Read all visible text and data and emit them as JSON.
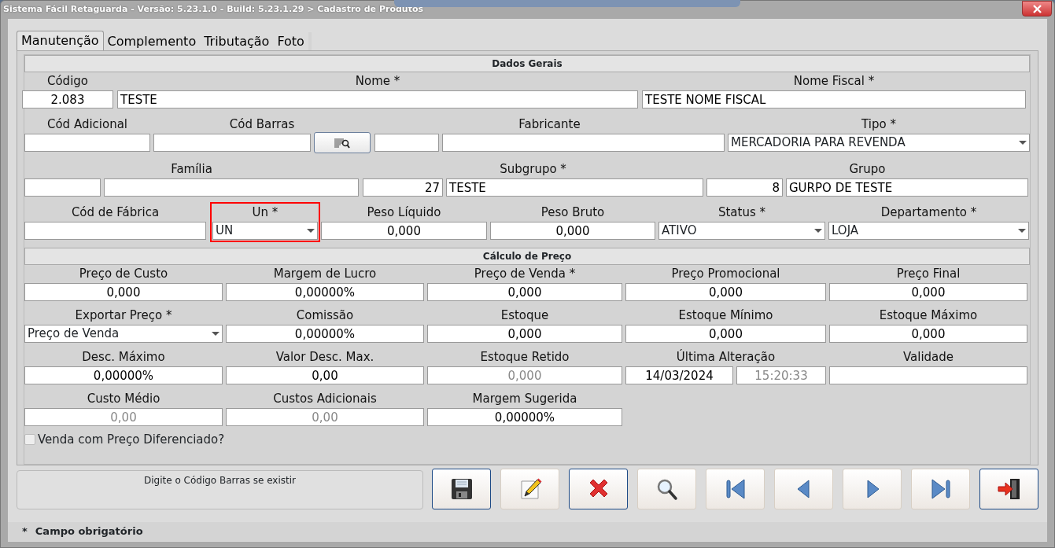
{
  "window": {
    "title": "Sistema Fácil Retaguarda - Versão: 5.23.1.0  - Build: 5.23.1.29 > Cadastro de Produtos"
  },
  "tabs": [
    {
      "label": "Manutenção",
      "selected": true
    },
    {
      "label": "Complemento",
      "selected": false
    },
    {
      "label": "Tributação",
      "selected": false
    },
    {
      "label": "Foto",
      "selected": false
    }
  ],
  "sections": [
    {
      "title": "Dados Gerais",
      "rows": [
        {
          "fields": [
            {
              "label": "Código",
              "inputs": [
                {
                  "kind": "text",
                  "value": "2.083"
                }
              ]
            },
            {
              "label": "Nome *",
              "inputs": [
                {
                  "kind": "text",
                  "value": "TESTE"
                }
              ]
            },
            {
              "label": "Nome Fiscal *",
              "inputs": [
                {
                  "kind": "text",
                  "value": "TESTE NOME FISCAL"
                }
              ]
            }
          ]
        },
        {
          "fields": [
            {
              "label": "Cód Adicional",
              "inputs": [
                {
                  "kind": "text"
                }
              ]
            },
            {
              "label": "Cód Barras",
              "inputs": [
                {
                  "kind": "text"
                },
                {
                  "kind": "button"
                }
              ]
            },
            {
              "label": "Fabricante",
              "inputs": [
                {
                  "kind": "text"
                },
                {
                  "kind": "text"
                }
              ]
            },
            {
              "label": "Tipo *",
              "inputs": [
                {
                  "kind": "select",
                  "value": "MERCADORIA PARA REVENDA"
                }
              ]
            }
          ]
        },
        {
          "fields": [
            {
              "label": "Família",
              "inputs": [
                {
                  "kind": "text"
                },
                {
                  "kind": "text"
                }
              ]
            },
            {
              "label": "Subgrupo *",
              "inputs": [
                {
                  "kind": "text",
                  "value": "27"
                },
                {
                  "kind": "text",
                  "value": "TESTE"
                }
              ]
            },
            {
              "label": "Grupo",
              "inputs": [
                {
                  "kind": "text",
                  "value": "8"
                },
                {
                  "kind": "text",
                  "value": "GURPO DE TESTE"
                }
              ]
            }
          ]
        },
        {
          "fields": [
            {
              "label": "Cód de Fábrica",
              "inputs": [
                {
                  "kind": "text"
                }
              ]
            },
            {
              "label": "Un *",
              "highlighted": true,
              "inputs": [
                {
                  "kind": "select",
                  "value": "UN"
                }
              ]
            },
            {
              "label": "Peso Líquido",
              "inputs": [
                {
                  "kind": "text",
                  "value": "0,000"
                }
              ]
            },
            {
              "label": "Peso Bruto",
              "inputs": [
                {
                  "kind": "text",
                  "value": "0,000"
                }
              ]
            },
            {
              "label": "Status *",
              "inputs": [
                {
                  "kind": "select",
                  "value": "ATIVO"
                }
              ]
            },
            {
              "label": "Departamento *",
              "inputs": [
                {
                  "kind": "select",
                  "value": "LOJA"
                }
              ]
            }
          ]
        }
      ]
    },
    {
      "title": "Cálculo de Preço",
      "rows": [
        {
          "fields": [
            {
              "label": "Preço de Custo",
              "inputs": [
                {
                  "kind": "text",
                  "value": "0,000"
                }
              ]
            },
            {
              "label": "Margem de Lucro",
              "inputs": [
                {
                  "kind": "text",
                  "value": "0,00000%"
                }
              ]
            },
            {
              "label": "Preço de Venda *",
              "inputs": [
                {
                  "kind": "text",
                  "value": "0,000"
                }
              ]
            },
            {
              "label": "Preço Promocional",
              "inputs": [
                {
                  "kind": "text",
                  "value": "0,000"
                }
              ]
            },
            {
              "label": "Preço Final",
              "inputs": [
                {
                  "kind": "text",
                  "value": "0,000"
                }
              ]
            }
          ]
        },
        {
          "fields": [
            {
              "label": "Exportar Preço *",
              "inputs": [
                {
                  "kind": "select",
                  "value": "Preço de Venda"
                }
              ]
            },
            {
              "label": "Comissão",
              "inputs": [
                {
                  "kind": "text",
                  "value": "0,00000%"
                }
              ]
            },
            {
              "label": "Estoque",
              "inputs": [
                {
                  "kind": "text",
                  "value": "0,000"
                }
              ]
            },
            {
              "label": "Estoque Mínimo",
              "inputs": [
                {
                  "kind": "text",
                  "value": "0,000"
                }
              ]
            },
            {
              "label": "Estoque Máximo",
              "inputs": [
                {
                  "kind": "text",
                  "value": "0,000"
                }
              ]
            }
          ]
        },
        {
          "fields": [
            {
              "label": "Desc. Máximo",
              "inputs": [
                {
                  "kind": "text",
                  "value": "0,00000%"
                }
              ]
            },
            {
              "label": "Valor Desc. Max.",
              "inputs": [
                {
                  "kind": "text",
                  "value": "0,00"
                }
              ]
            },
            {
              "label": "Estoque Retido",
              "inputs": [
                {
                  "kind": "text",
                  "value": "0,000",
                  "disabled": true
                }
              ]
            },
            {
              "label": "Última Alteração",
              "inputs": [
                {
                  "kind": "text",
                  "value": "14/03/2024"
                },
                {
                  "kind": "text",
                  "value": "15:20:33",
                  "disabled": true
                }
              ]
            },
            {
              "label": "Validade",
              "inputs": [
                {
                  "kind": "text"
                }
              ]
            }
          ]
        },
        {
          "fields": [
            {
              "label": "Custo Médio",
              "inputs": [
                {
                  "kind": "text",
                  "value": "0,00",
                  "disabled": true
                }
              ]
            },
            {
              "label": "Custos Adicionais",
              "inputs": [
                {
                  "kind": "text",
                  "value": "0,00",
                  "disabled": true
                }
              ]
            },
            {
              "label": "Margem Sugerida",
              "inputs": [
                {
                  "kind": "text",
                  "value": "0,00000%"
                }
              ]
            }
          ]
        }
      ]
    }
  ],
  "checkbox": {
    "label": "Venda com Preço Diferenciado?",
    "checked": false
  },
  "message": "Digite o Código Barras se existir",
  "toolbar": [
    {
      "kind": "save",
      "highlighted": true
    },
    {
      "kind": "edit",
      "highlighted": false
    },
    {
      "kind": "delete",
      "highlighted": true
    },
    {
      "kind": "search",
      "highlighted": false
    },
    {
      "kind": "first",
      "highlighted": false
    },
    {
      "kind": "previous",
      "highlighted": false
    },
    {
      "kind": "next",
      "highlighted": false
    },
    {
      "kind": "last",
      "highlighted": false
    },
    {
      "kind": "exit",
      "highlighted": true
    }
  ],
  "footer": {
    "mark": "*",
    "text": "Campo obrigatório"
  }
}
